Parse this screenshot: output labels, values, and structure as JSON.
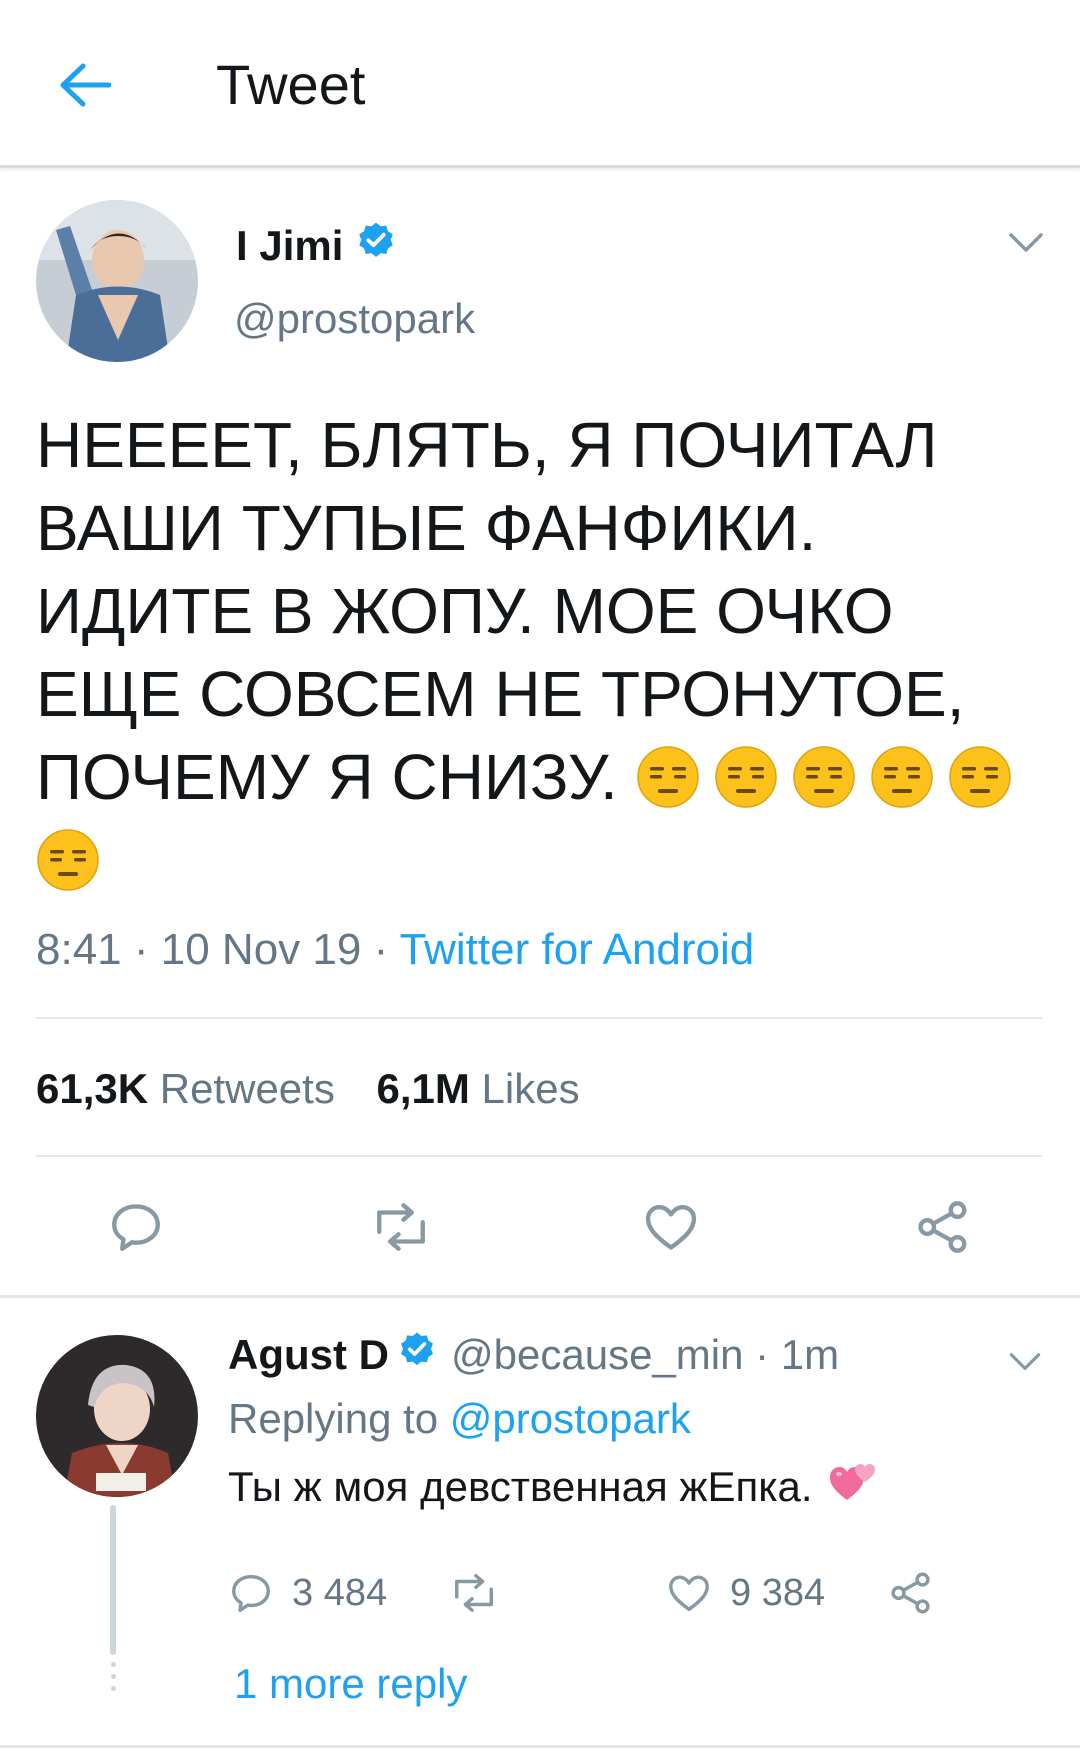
{
  "header": {
    "title": "Tweet",
    "back_icon": "arrow-left-icon"
  },
  "colors": {
    "accent": "#1da1f2",
    "text": "#14171a",
    "secondary": "#657786",
    "divider": "#e1e8ed",
    "emoji": "#fcc21b"
  },
  "tweet": {
    "author_name": "I Jimi",
    "author_handle": "@prostopark",
    "verified": true,
    "text": "НЕЕЕЕТ, БЛЯТЬ, Я ПОЧИТАЛ ВАШИ ТУПЫЕ ФАНФИКИ. ИДИТЕ В ЖОПУ. МОЕ ОЧКО ЕЩЕ СОВСЕМ НЕ ТРОНУТОЕ, ПОЧЕМУ Я СНИЗУ.",
    "emoji_name": "expressionless-face",
    "emoji_count": 6,
    "time": "8:41",
    "date": "10 Nov 19",
    "source": "Twitter for Android",
    "retweets_count": "61,3K",
    "retweets_label": "Retweets",
    "likes_count": "6,1M",
    "likes_label": "Likes"
  },
  "reply": {
    "author_name": "Agust D",
    "author_handle": "@because_min",
    "time_ago": "1m",
    "verified": true,
    "replying_label": "Replying to",
    "replying_to": "@prostopark",
    "text": "Ты ж моя девственная жЕпка.",
    "emoji_name": "two-hearts",
    "reply_count": "3 484",
    "like_count": "9 384",
    "more_replies": "1 more reply"
  }
}
